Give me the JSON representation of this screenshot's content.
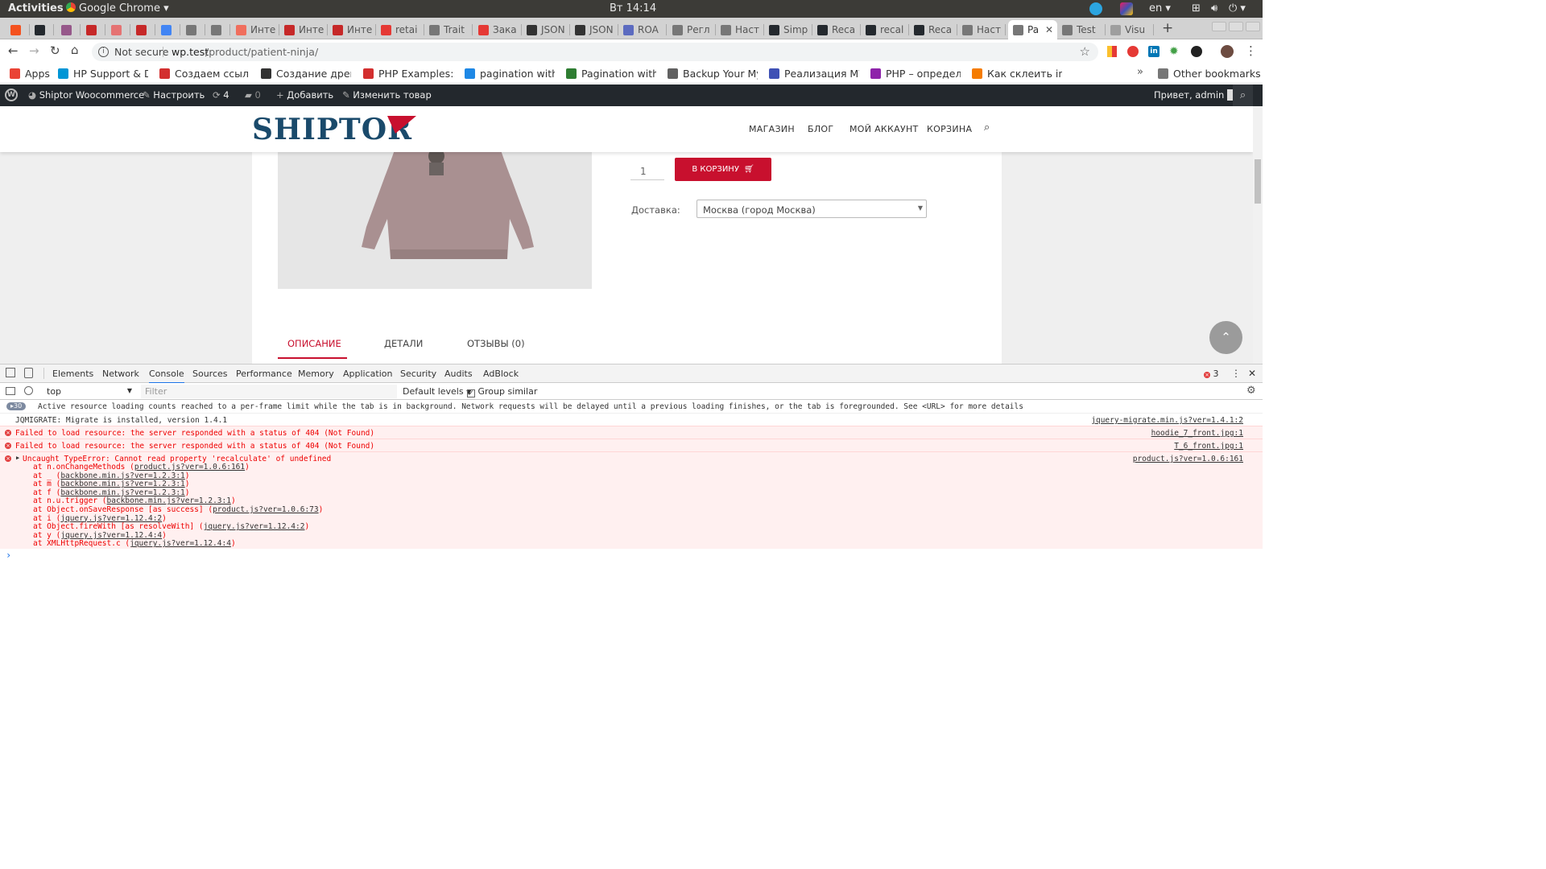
{
  "os": {
    "activities": "Activities",
    "app": "Google Chrome",
    "clock": "Вт 14:14",
    "lang": "en"
  },
  "tabs": [
    {
      "label": "",
      "color": "#f4511e"
    },
    {
      "label": "",
      "color": "#24292e"
    },
    {
      "label": "",
      "color": "#96588a"
    },
    {
      "label": "",
      "color": "#c62828"
    },
    {
      "label": "",
      "color": "#e57373"
    },
    {
      "label": "",
      "color": "#c62828"
    },
    {
      "label": "",
      "color": "#4285f4"
    },
    {
      "label": "",
      "color": "#777777"
    },
    {
      "label": "",
      "color": "#777777"
    },
    {
      "label": "Инте",
      "color": "#f06e5d"
    },
    {
      "label": "Инте",
      "color": "#c62828"
    },
    {
      "label": "Инте",
      "color": "#c62828"
    },
    {
      "label": "retai",
      "color": "#e53935"
    },
    {
      "label": "Trait",
      "color": "#777777"
    },
    {
      "label": "Зака",
      "color": "#e53935"
    },
    {
      "label": "JSON",
      "color": "#333333"
    },
    {
      "label": "JSON",
      "color": "#333333"
    },
    {
      "label": "ROA",
      "color": "#5c6bc0"
    },
    {
      "label": "Регл",
      "color": "#777777"
    },
    {
      "label": "Наст",
      "color": "#777777"
    },
    {
      "label": "Simp",
      "color": "#24292e"
    },
    {
      "label": "Reca",
      "color": "#24292e"
    },
    {
      "label": "recal",
      "color": "#24292e"
    },
    {
      "label": "Reca",
      "color": "#24292e"
    },
    {
      "label": "Наст",
      "color": "#777777"
    },
    {
      "label": "Pa",
      "color": "#777777",
      "active": true
    },
    {
      "label": "Test",
      "color": "#777777"
    },
    {
      "label": "Visu",
      "color": "#9e9e9e"
    }
  ],
  "address": {
    "security": "Not secure",
    "url_host": "wp.test",
    "url_path": "/product/patient-ninja/"
  },
  "bookmarks": [
    {
      "label": "Apps",
      "color": "#ea4335"
    },
    {
      "label": "HP Support & D",
      "color": "#0096d6"
    },
    {
      "label": "Создаем ссылку",
      "color": "#d32f2f"
    },
    {
      "label": "Создание древо",
      "color": "#333333"
    },
    {
      "label": "PHP Examples: S",
      "color": "#d32f2f"
    },
    {
      "label": "pagination with",
      "color": "#1e88e5"
    },
    {
      "label": "Pagination with",
      "color": "#2e7d32"
    },
    {
      "label": "Backup Your My",
      "color": "#616161"
    },
    {
      "label": "Реализация MV",
      "color": "#3f51b5"
    },
    {
      "label": "PHP – определе",
      "color": "#8e24aa"
    },
    {
      "label": "Как склеить ind",
      "color": "#f57c00"
    }
  ],
  "bookmarks_more": "»",
  "bookmarks_other": "Other bookmarks",
  "wp": {
    "site": "Shiptor Woocommerce",
    "customize": "Настроить",
    "updates": "4",
    "comments": "0",
    "add": "Добавить",
    "edit": "Изменить товар",
    "greeting": "Привет, admin"
  },
  "site": {
    "logo": "SHIPTOR",
    "menu": [
      "МАГАЗИН",
      "БЛОГ",
      "МОЙ АККАУНТ",
      "КОРЗИНА"
    ],
    "qty": "1",
    "add_to_cart": "В КОРЗИНУ",
    "delivery_label": "Доставка:",
    "delivery_value": "Москва (город Москва)",
    "tabs": [
      "ОПИСАНИЕ",
      "ДЕТАЛИ",
      "ОТЗЫВЫ (0)"
    ]
  },
  "devtools": {
    "tabs": [
      "Elements",
      "Network",
      "Console",
      "Sources",
      "Performance",
      "Memory",
      "Application",
      "Security",
      "Audits",
      "AdBlock"
    ],
    "error_count": "3",
    "context": "top",
    "filter_placeholder": "Filter",
    "levels": "Default levels",
    "group_similar": "Group similar",
    "messages": [
      {
        "type": "info",
        "badge": "30",
        "text": "Active resource loading counts reached to a per-frame limit while the tab is in background. Network requests will be delayed until a previous loading finishes, or the tab is foregrounded. See <URL> for more details",
        "source": ""
      },
      {
        "type": "log",
        "text": "JQMIGRATE: Migrate is installed, version 1.4.1",
        "source": "jquery-migrate.min.js?ver=1.4.1:2"
      },
      {
        "type": "error",
        "text": "Failed to load resource: the server responded with a status of 404 (Not Found)",
        "source": "hoodie_7_front.jpg:1"
      },
      {
        "type": "error",
        "text": "Failed to load resource: the server responded with a status of 404 (Not Found)",
        "source": "T_6_front.jpg:1"
      },
      {
        "type": "error",
        "text": "Uncaught TypeError: Cannot read property 'recalculate' of undefined",
        "source": "product.js?ver=1.0.6:161"
      }
    ],
    "trace": [
      {
        "fn": "at n.onChangeMethods (",
        "loc": "product.js?ver=1.0.6:161",
        "end": ")"
      },
      {
        "fn": "at _ (",
        "loc": "backbone.min.js?ver=1.2.3:1",
        "end": ")"
      },
      {
        "fn": "at m (",
        "loc": "backbone.min.js?ver=1.2.3:1",
        "end": ")"
      },
      {
        "fn": "at f (",
        "loc": "backbone.min.js?ver=1.2.3:1",
        "end": ")"
      },
      {
        "fn": "at n.u.trigger (",
        "loc": "backbone.min.js?ver=1.2.3:1",
        "end": ")"
      },
      {
        "fn": "at Object.onSaveResponse [as success] (",
        "loc": "product.js?ver=1.0.6:73",
        "end": ")"
      },
      {
        "fn": "at i (",
        "loc": "jquery.js?ver=1.12.4:2",
        "end": ")"
      },
      {
        "fn": "at Object.fireWith [as resolveWith] (",
        "loc": "jquery.js?ver=1.12.4:2",
        "end": ")"
      },
      {
        "fn": "at y (",
        "loc": "jquery.js?ver=1.12.4:4",
        "end": ")"
      },
      {
        "fn": "at XMLHttpRequest.c (",
        "loc": "jquery.js?ver=1.12.4:4",
        "end": ")"
      }
    ],
    "prompt": "›"
  },
  "colors": {
    "brand_red": "#c8102e",
    "logo_navy": "#1a4a6b",
    "wp_bar": "#23282d",
    "error_red": "#e23c3c"
  }
}
